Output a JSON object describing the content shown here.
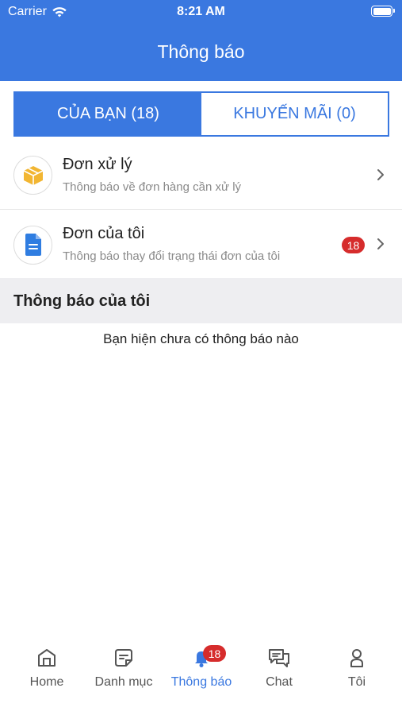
{
  "status_bar": {
    "carrier": "Carrier",
    "time": "8:21 AM"
  },
  "header": {
    "title": "Thông báo"
  },
  "tabs": [
    {
      "label": "CỦA BẠN (18)",
      "active": true
    },
    {
      "label": "KHUYẾN MÃI (0)",
      "active": false
    }
  ],
  "rows": [
    {
      "title": "Đơn xử lý",
      "subtitle": "Thông báo về đơn hàng cần xử lý",
      "icon": "package-icon"
    },
    {
      "title": "Đơn của tôi",
      "subtitle": "Thông báo thay đổi trạng thái đơn của tôi",
      "icon": "document-icon",
      "badge": "18"
    }
  ],
  "section": {
    "title": "Thông báo của tôi",
    "empty_text": "Bạn hiện chưa có thông báo nào"
  },
  "tabbar": {
    "items": [
      {
        "label": "Home",
        "icon": "home-icon"
      },
      {
        "label": "Danh mục",
        "icon": "category-icon"
      },
      {
        "label": "Thông báo",
        "icon": "bell-icon",
        "badge": "18",
        "active": true
      },
      {
        "label": "Chat",
        "icon": "chat-icon"
      },
      {
        "label": "Tôi",
        "icon": "user-icon"
      }
    ]
  },
  "colors": {
    "primary": "#3a78e0",
    "badge": "#d62c2c",
    "package": "#f2b632",
    "document": "#2f7de1"
  }
}
